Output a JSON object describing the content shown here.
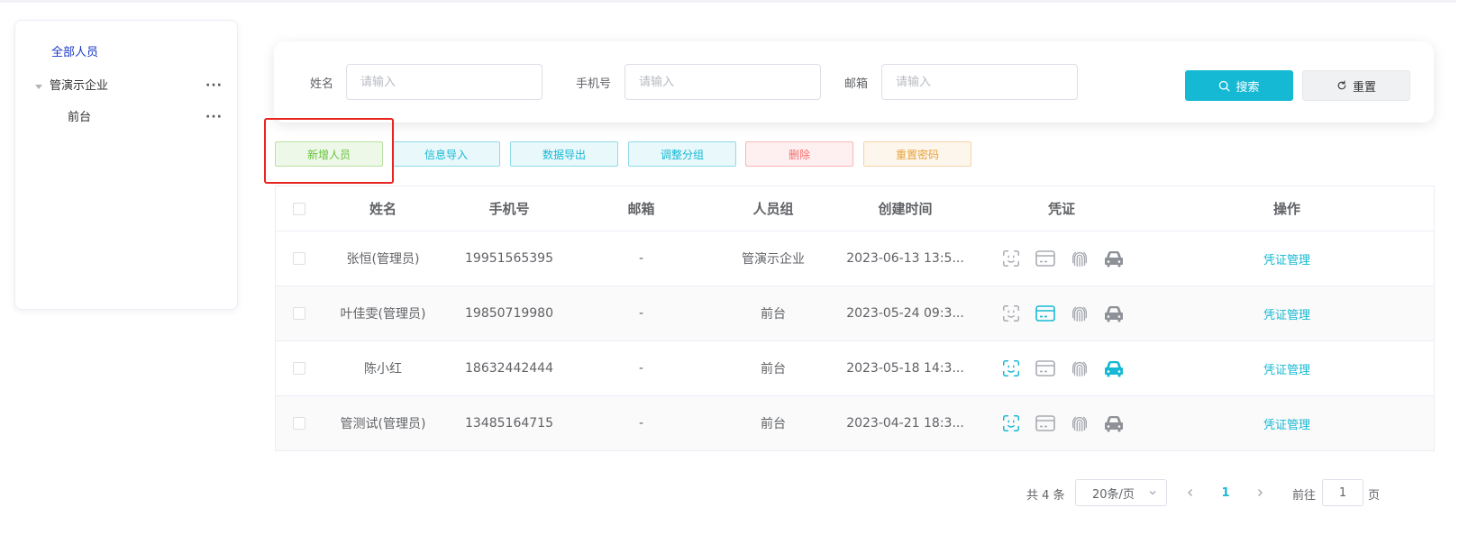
{
  "tree": {
    "all_label": "全部人员",
    "company_label": "管演示企业",
    "front_label": "前台",
    "more_label": "···"
  },
  "search": {
    "name_label": "姓名",
    "phone_label": "手机号",
    "email_label": "邮箱",
    "placeholder": "请输入",
    "search_button": "搜索",
    "reset_button": "重置"
  },
  "actions": {
    "add": "新增人员",
    "import": "信息导入",
    "export": "数据导出",
    "group": "调整分组",
    "delete": "删除",
    "reset_password": "重置密码"
  },
  "table": {
    "headers": {
      "name": "姓名",
      "phone": "手机号",
      "email": "邮箱",
      "group": "人员组",
      "created": "创建时间",
      "credentials": "凭证",
      "operation": "操作"
    },
    "rows": [
      {
        "name": "张恒(管理员)",
        "phone": "19951565395",
        "email": "-",
        "group": "管演示企业",
        "created": "2023-06-13 13:5...",
        "face": false,
        "card": false,
        "finger": false,
        "car": false,
        "op": "凭证管理"
      },
      {
        "name": "叶佳雯(管理员)",
        "phone": "19850719980",
        "email": "-",
        "group": "前台",
        "created": "2023-05-24 09:3...",
        "face": false,
        "card": true,
        "finger": false,
        "car": false,
        "op": "凭证管理"
      },
      {
        "name": "陈小红",
        "phone": "18632442444",
        "email": "-",
        "group": "前台",
        "created": "2023-05-18 14:3...",
        "face": true,
        "card": false,
        "finger": false,
        "car": true,
        "op": "凭证管理"
      },
      {
        "name": "管测试(管理员)",
        "phone": "13485164715",
        "email": "-",
        "group": "前台",
        "created": "2023-04-21 18:3...",
        "face": true,
        "card": false,
        "finger": false,
        "car": false,
        "op": "凭证管理"
      }
    ]
  },
  "pagination": {
    "total": "共 4 条",
    "page_size": "20条/页",
    "current_page": "1",
    "goto_label": "前往",
    "goto_value": "1",
    "page_suffix": "页"
  },
  "colors": {
    "accent": "#16b9d4",
    "inactive_icon": "#a8abb2",
    "highlight": "#e8261f"
  }
}
